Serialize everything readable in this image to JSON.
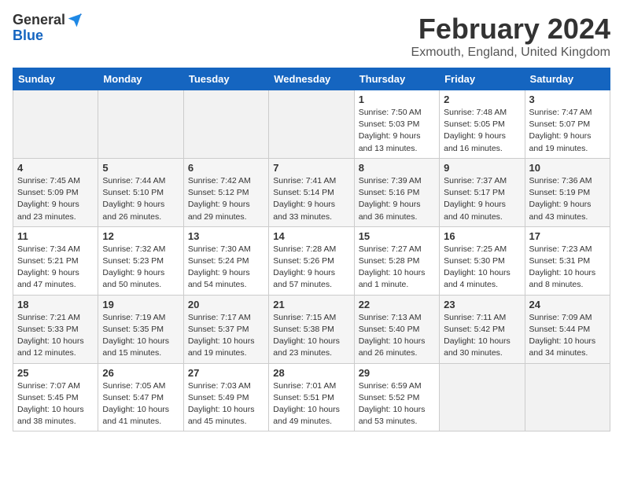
{
  "header": {
    "logo_line1": "General",
    "logo_line2": "Blue",
    "month_year": "February 2024",
    "location": "Exmouth, England, United Kingdom"
  },
  "weekdays": [
    "Sunday",
    "Monday",
    "Tuesday",
    "Wednesday",
    "Thursday",
    "Friday",
    "Saturday"
  ],
  "weeks": [
    [
      {
        "num": "",
        "detail": ""
      },
      {
        "num": "",
        "detail": ""
      },
      {
        "num": "",
        "detail": ""
      },
      {
        "num": "",
        "detail": ""
      },
      {
        "num": "1",
        "detail": "Sunrise: 7:50 AM\nSunset: 5:03 PM\nDaylight: 9 hours\nand 13 minutes."
      },
      {
        "num": "2",
        "detail": "Sunrise: 7:48 AM\nSunset: 5:05 PM\nDaylight: 9 hours\nand 16 minutes."
      },
      {
        "num": "3",
        "detail": "Sunrise: 7:47 AM\nSunset: 5:07 PM\nDaylight: 9 hours\nand 19 minutes."
      }
    ],
    [
      {
        "num": "4",
        "detail": "Sunrise: 7:45 AM\nSunset: 5:09 PM\nDaylight: 9 hours\nand 23 minutes."
      },
      {
        "num": "5",
        "detail": "Sunrise: 7:44 AM\nSunset: 5:10 PM\nDaylight: 9 hours\nand 26 minutes."
      },
      {
        "num": "6",
        "detail": "Sunrise: 7:42 AM\nSunset: 5:12 PM\nDaylight: 9 hours\nand 29 minutes."
      },
      {
        "num": "7",
        "detail": "Sunrise: 7:41 AM\nSunset: 5:14 PM\nDaylight: 9 hours\nand 33 minutes."
      },
      {
        "num": "8",
        "detail": "Sunrise: 7:39 AM\nSunset: 5:16 PM\nDaylight: 9 hours\nand 36 minutes."
      },
      {
        "num": "9",
        "detail": "Sunrise: 7:37 AM\nSunset: 5:17 PM\nDaylight: 9 hours\nand 40 minutes."
      },
      {
        "num": "10",
        "detail": "Sunrise: 7:36 AM\nSunset: 5:19 PM\nDaylight: 9 hours\nand 43 minutes."
      }
    ],
    [
      {
        "num": "11",
        "detail": "Sunrise: 7:34 AM\nSunset: 5:21 PM\nDaylight: 9 hours\nand 47 minutes."
      },
      {
        "num": "12",
        "detail": "Sunrise: 7:32 AM\nSunset: 5:23 PM\nDaylight: 9 hours\nand 50 minutes."
      },
      {
        "num": "13",
        "detail": "Sunrise: 7:30 AM\nSunset: 5:24 PM\nDaylight: 9 hours\nand 54 minutes."
      },
      {
        "num": "14",
        "detail": "Sunrise: 7:28 AM\nSunset: 5:26 PM\nDaylight: 9 hours\nand 57 minutes."
      },
      {
        "num": "15",
        "detail": "Sunrise: 7:27 AM\nSunset: 5:28 PM\nDaylight: 10 hours\nand 1 minute."
      },
      {
        "num": "16",
        "detail": "Sunrise: 7:25 AM\nSunset: 5:30 PM\nDaylight: 10 hours\nand 4 minutes."
      },
      {
        "num": "17",
        "detail": "Sunrise: 7:23 AM\nSunset: 5:31 PM\nDaylight: 10 hours\nand 8 minutes."
      }
    ],
    [
      {
        "num": "18",
        "detail": "Sunrise: 7:21 AM\nSunset: 5:33 PM\nDaylight: 10 hours\nand 12 minutes."
      },
      {
        "num": "19",
        "detail": "Sunrise: 7:19 AM\nSunset: 5:35 PM\nDaylight: 10 hours\nand 15 minutes."
      },
      {
        "num": "20",
        "detail": "Sunrise: 7:17 AM\nSunset: 5:37 PM\nDaylight: 10 hours\nand 19 minutes."
      },
      {
        "num": "21",
        "detail": "Sunrise: 7:15 AM\nSunset: 5:38 PM\nDaylight: 10 hours\nand 23 minutes."
      },
      {
        "num": "22",
        "detail": "Sunrise: 7:13 AM\nSunset: 5:40 PM\nDaylight: 10 hours\nand 26 minutes."
      },
      {
        "num": "23",
        "detail": "Sunrise: 7:11 AM\nSunset: 5:42 PM\nDaylight: 10 hours\nand 30 minutes."
      },
      {
        "num": "24",
        "detail": "Sunrise: 7:09 AM\nSunset: 5:44 PM\nDaylight: 10 hours\nand 34 minutes."
      }
    ],
    [
      {
        "num": "25",
        "detail": "Sunrise: 7:07 AM\nSunset: 5:45 PM\nDaylight: 10 hours\nand 38 minutes."
      },
      {
        "num": "26",
        "detail": "Sunrise: 7:05 AM\nSunset: 5:47 PM\nDaylight: 10 hours\nand 41 minutes."
      },
      {
        "num": "27",
        "detail": "Sunrise: 7:03 AM\nSunset: 5:49 PM\nDaylight: 10 hours\nand 45 minutes."
      },
      {
        "num": "28",
        "detail": "Sunrise: 7:01 AM\nSunset: 5:51 PM\nDaylight: 10 hours\nand 49 minutes."
      },
      {
        "num": "29",
        "detail": "Sunrise: 6:59 AM\nSunset: 5:52 PM\nDaylight: 10 hours\nand 53 minutes."
      },
      {
        "num": "",
        "detail": ""
      },
      {
        "num": "",
        "detail": ""
      }
    ]
  ]
}
